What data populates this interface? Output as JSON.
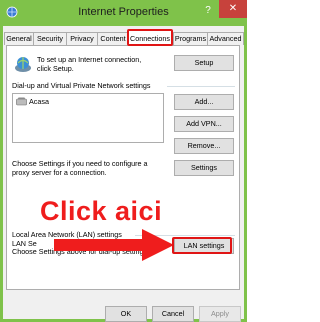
{
  "window": {
    "title": "Internet Properties",
    "help_glyph": "?",
    "close_glyph": "✕"
  },
  "tabs": [
    {
      "label": "General",
      "active": false
    },
    {
      "label": "Security",
      "active": false
    },
    {
      "label": "Privacy",
      "active": false
    },
    {
      "label": "Content",
      "active": false
    },
    {
      "label": "Connections",
      "active": true
    },
    {
      "label": "Programs",
      "active": false
    },
    {
      "label": "Advanced",
      "active": false
    }
  ],
  "connections": {
    "setup_text": "To set up an Internet connection, click Setup.",
    "setup_button": "Setup",
    "dialup_heading": "Dial-up and Virtual Private Network settings",
    "list_items": [
      {
        "label": "Acasa",
        "icon": "dialup-connection-icon"
      }
    ],
    "add_button": "Add...",
    "add_vpn_button": "Add VPN...",
    "remove_button": "Remove...",
    "proxy_text": "Choose Settings if you need to configure a proxy server for a connection.",
    "settings_button": "Settings",
    "lan_heading": "Local Area Network (LAN) settings",
    "lan_text_line1": "LAN Se",
    "lan_text_line2": "Choose Settings above for dial-up settings.",
    "lan_settings_button": "LAN settings"
  },
  "annotation": {
    "text": "Click aici",
    "color": "#ef1d1d"
  },
  "footer": {
    "ok": "OK",
    "cancel": "Cancel",
    "apply": "Apply"
  },
  "colors": {
    "titlebar": "#7fc24a",
    "close": "#c7423c",
    "highlight": "#e01515"
  }
}
